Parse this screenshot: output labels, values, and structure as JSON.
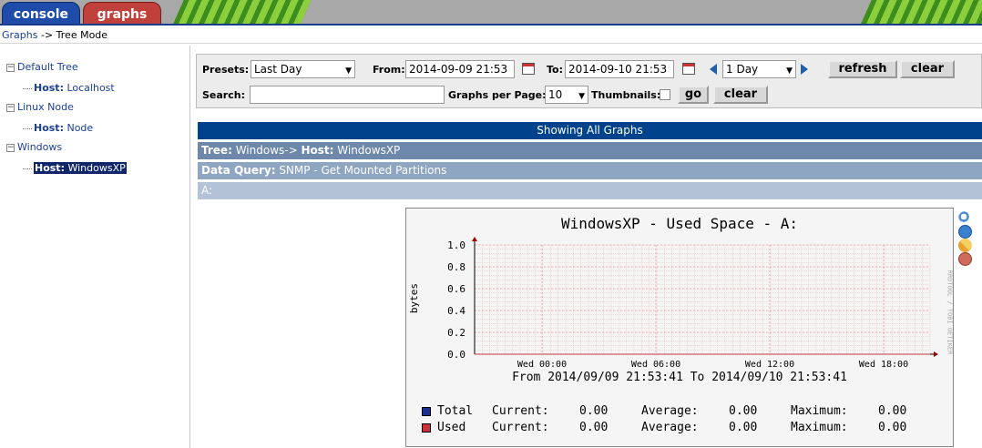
{
  "tabs": {
    "console": "console",
    "graphs": "graphs"
  },
  "breadcrumb": {
    "root": "Graphs",
    "sep": " -> ",
    "current": "Tree Mode"
  },
  "tree": {
    "nodes": [
      {
        "label": "Default Tree",
        "host_prefix": "Host:",
        "host": "Localhost"
      },
      {
        "label": "Linux Node",
        "host_prefix": "Host:",
        "host": "Node"
      },
      {
        "label": "Windows",
        "host_prefix": "Host:",
        "host": "WindowsXP"
      }
    ],
    "expander": "−"
  },
  "filter": {
    "presets_label": "Presets:",
    "presets_value": "Last Day",
    "from_label": "From:",
    "from_value": "2014-09-09 21:53",
    "to_label": "To:",
    "to_value": "2014-09-10 21:53",
    "span_value": "1 Day",
    "refresh_label": "refresh",
    "clear_label": "clear",
    "search_label": "Search:",
    "search_value": "",
    "gpp_label": "Graphs per Page:",
    "gpp_value": "10",
    "thumbnails_label": "Thumbnails:",
    "go_label": "go",
    "clear2_label": "clear"
  },
  "results": {
    "showing": "Showing All Graphs",
    "tree_label": "Tree:",
    "tree_value": " Windows-> ",
    "host_label": "Host:",
    "host_value": " WindowsXP",
    "dq_label": "Data Query:",
    "dq_value": " SNMP - Get Mounted Partitions",
    "item": "A:"
  },
  "chart_data": {
    "type": "line",
    "title": "WindowsXP - Used Space - A:",
    "ylabel": "bytes",
    "side_label": "RRDTOOL / TOBI OETIKER",
    "ylim": [
      0,
      1.0
    ],
    "yticks": [
      "1.0",
      "0.8",
      "0.6",
      "0.4",
      "0.2",
      "0.0"
    ],
    "xticks": [
      "Wed 00:00",
      "Wed 06:00",
      "Wed 12:00",
      "Wed 18:00"
    ],
    "range_text": "From 2014/09/09 21:53:41 To 2014/09/10 21:53:41",
    "series": [
      {
        "name": "Total",
        "color": "#1a2f8c",
        "current": "0.00",
        "average": "0.00",
        "maximum": "0.00"
      },
      {
        "name": "Used",
        "color": "#c8323a",
        "current": "0.00",
        "average": "0.00",
        "maximum": "0.00"
      }
    ],
    "stat_labels": {
      "current": "Current:",
      "average": "Average:",
      "maximum": "Maximum:"
    }
  }
}
